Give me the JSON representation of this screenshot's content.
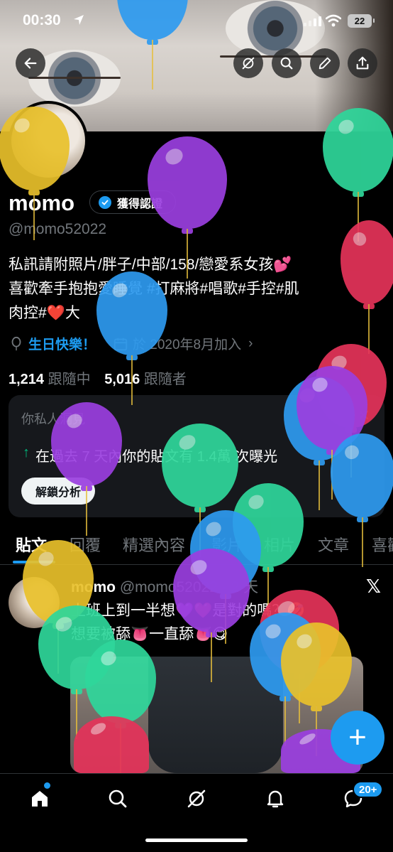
{
  "status_bar": {
    "time": "00:30",
    "battery": "22"
  },
  "header": {
    "back_icon": "arrow-left-icon",
    "actions": [
      "grok-icon",
      "search-icon",
      "edit-icon",
      "share-icon"
    ]
  },
  "profile": {
    "name": "momo",
    "verified_label": "獲得認證",
    "handle": "@momo52022",
    "bio_line1": "私訊請附照片/胖子/中部/158/戀愛系女孩💕",
    "bio_line2": "喜歡牽手抱抱愛睡覺 #打麻將#唱歌#手控#肌",
    "bio_line3_a": "肉控#",
    "bio_line3_heart": "❤️",
    "bio_line3_b": "大",
    "birthday": "生日快樂！",
    "joined": "於 2020年8月加入",
    "following_count": "1,214",
    "following_label": "跟隨中",
    "followers_count": "5,016",
    "followers_label": "跟隨者"
  },
  "insight_card": {
    "title": "你私人洞見",
    "stat": "在過去 7 天內你的貼文有 1.4萬 次曝光",
    "button": "解鎖分析"
  },
  "tabs": [
    "貼文",
    "回覆",
    "精選內容",
    "影片",
    "相片",
    "文章",
    "喜歡"
  ],
  "post": {
    "name": "momo",
    "handle": "@momo52022",
    "time": "· 2 天",
    "line1": "上班上到一半想💜❤️是對的嗎？🤣",
    "line2": "想要被舔👅一直舔👅😋"
  },
  "fab_label": "+",
  "nav": {
    "items": [
      "home-icon",
      "search-icon",
      "grok-icon",
      "bell-icon",
      "messages-icon"
    ],
    "messages_badge": "20+"
  },
  "colors": {
    "accent": "#1d9bf0",
    "background": "#000000",
    "muted": "#71767b",
    "green": "#00ba7c"
  }
}
